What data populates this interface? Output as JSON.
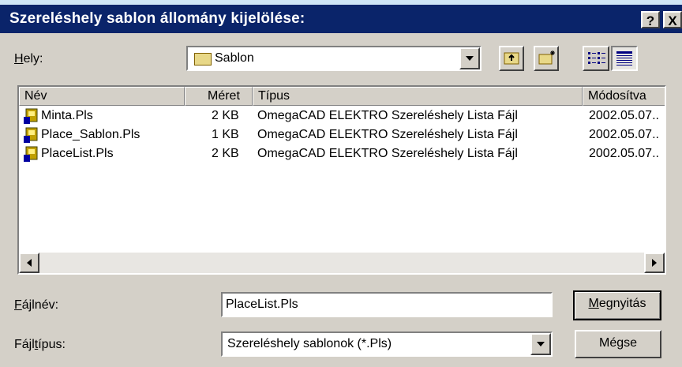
{
  "dialog": {
    "title": "Szereléshely sablon állomány kijelölése:",
    "help_button": "?",
    "close_button": "X"
  },
  "location": {
    "label_prefix": "H",
    "label_rest": "ely:",
    "value": "Sablon"
  },
  "toolbar": {
    "up_icon": "up-folder-icon",
    "new_folder_icon": "new-folder-icon",
    "list_view_icon": "list-view-icon",
    "details_view_icon": "details-view-icon"
  },
  "file_list": {
    "columns": [
      "Név",
      "Méret",
      "Típus",
      "Módosítva"
    ],
    "rows": [
      {
        "name": "Minta.Pls",
        "size": "2 KB",
        "type": "OmegaCAD ELEKTRO Szereléshely Lista Fájl",
        "modified": "2002.05.07.."
      },
      {
        "name": "Place_Sablon.Pls",
        "size": "1 KB",
        "type": "OmegaCAD ELEKTRO Szereléshely Lista Fájl",
        "modified": "2002.05.07.."
      },
      {
        "name": "PlaceList.Pls",
        "size": "2 KB",
        "type": "OmegaCAD ELEKTRO Szereléshely Lista Fájl",
        "modified": "2002.05.07.."
      }
    ]
  },
  "filename": {
    "label_prefix": "F",
    "label_rest": "ájlnév:",
    "value": "PlaceList.Pls"
  },
  "filetype": {
    "label_prefix": "Fájl",
    "label_mid": "t",
    "label_rest": "ípus:",
    "value": "Szereléshely sablonok (*.Pls)"
  },
  "buttons": {
    "open_prefix": "M",
    "open_rest": "egnyitás",
    "cancel": "Mégse"
  }
}
